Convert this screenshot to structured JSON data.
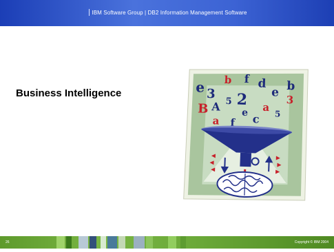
{
  "header": {
    "group": "IBM Software Group",
    "separator": "|",
    "division": "DB2 Information Management Software"
  },
  "slide": {
    "title": "Business Intelligence"
  },
  "clipart": {
    "letters": [
      "e",
      "3",
      "b",
      "f",
      "d",
      "e",
      "b",
      "B",
      "A",
      "5",
      "2",
      "a",
      "3",
      "a",
      "f",
      "c",
      "5",
      "e"
    ]
  },
  "footer": {
    "page_number": "26",
    "copyright": "Copyright © IBM 2004"
  },
  "colors": {
    "header_blue": "#2f55c8",
    "footer_green": "#6aa838",
    "funnel_navy": "#23308a",
    "letter_red": "#c8202a"
  }
}
